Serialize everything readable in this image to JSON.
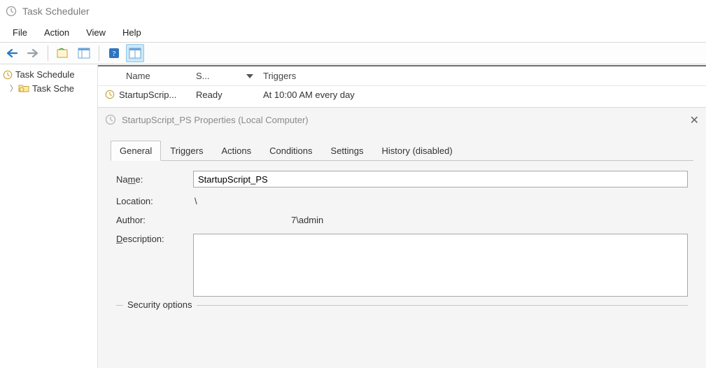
{
  "window": {
    "title": "Task Scheduler"
  },
  "menu": {
    "file": "File",
    "action": "Action",
    "view": "View",
    "help": "Help"
  },
  "tree": {
    "root": "Task Schedule",
    "child": "Task Sche"
  },
  "list": {
    "headers": {
      "name": "Name",
      "status": "S...",
      "triggers": "Triggers"
    },
    "rows": [
      {
        "name": "StartupScrip...",
        "status": "Ready",
        "triggers": "At 10:00 AM every day"
      }
    ]
  },
  "dialog": {
    "title": "StartupScript_PS Properties (Local Computer)",
    "tabs": {
      "general": "General",
      "triggers": "Triggers",
      "actions": "Actions",
      "conditions": "Conditions",
      "settings": "Settings",
      "history": "History (disabled)"
    },
    "labels": {
      "name": "Name:",
      "location": "Location:",
      "author": "Author:",
      "description": "Description:",
      "security": "Security options"
    },
    "values": {
      "name": "StartupScript_PS",
      "location": "\\",
      "author": "7\\admin",
      "description": ""
    }
  }
}
